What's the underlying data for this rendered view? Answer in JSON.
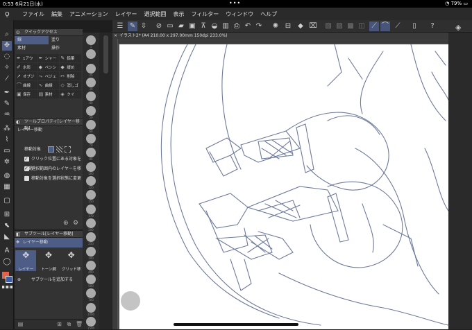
{
  "status": {
    "time": "0:53",
    "date": "6月21日(水)",
    "dots": "•••",
    "battery": "79%"
  },
  "menu": [
    "ファイル",
    "編集",
    "アニメーション",
    "レイヤー",
    "選択範囲",
    "表示",
    "フィルター",
    "ウィンドウ",
    "ヘルプ"
  ],
  "quick_access": {
    "title": "クイックアクセス",
    "tabs": [
      "線",
      "塗り",
      "素材",
      "操作"
    ],
    "items": [
      "1アウ",
      "シャー",
      "鉛筆",
      "水彩",
      "ペンシ",
      "緩め",
      "オブジ",
      "ベジェ",
      "削除",
      "曲線",
      "曲線",
      "消しゴ",
      "保存",
      "素材",
      "クイ"
    ]
  },
  "tool_property": {
    "title": "ツールプロパティ[レイヤー移動]",
    "tool_name": "レイヤー移動",
    "target_label": "移動対象",
    "options": [
      {
        "label": "クリック位置にある対象を移動",
        "checked": true
      },
      {
        "label": "選択範囲内のレイヤーを移動",
        "checked": true
      },
      {
        "label": "移動対象を選択状態に変更",
        "checked": false
      }
    ]
  },
  "sub_tool": {
    "title": "サブツール[レイヤー移動]",
    "group": "レイヤー移動",
    "tools": [
      "レイヤー",
      "トーン網",
      "グリッド移"
    ],
    "add_label": "サブツールを追加する"
  },
  "document": {
    "tab_label": "イラスト2* (A4 210.00 x 297.00mm 150dpi 233.0%)"
  },
  "brush_sizes": [
    "1",
    "",
    "25",
    "30",
    "40",
    "50",
    "60",
    "70",
    "80",
    "100",
    "120",
    "150",
    "170",
    "200",
    "250",
    "300",
    "400",
    "500",
    "700",
    "1000",
    "1500"
  ],
  "colors": {
    "main": "#e2644a",
    "sub": "#3d5ca8",
    "accent": "#4e5d86"
  }
}
